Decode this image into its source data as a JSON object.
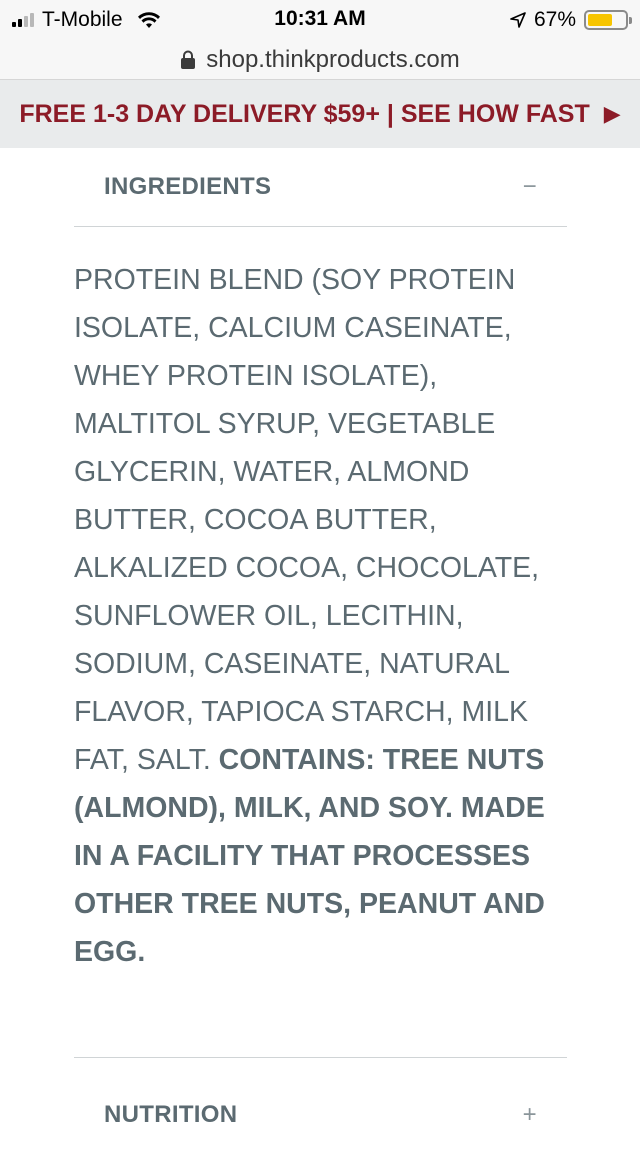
{
  "status_bar": {
    "carrier": "T-Mobile",
    "time": "10:31 AM",
    "battery_percent": "67%",
    "battery_level": 0.67,
    "icons": [
      "signal-icon",
      "wifi-icon",
      "location-arrow-icon",
      "battery-icon"
    ]
  },
  "browser": {
    "url": "shop.thinkproducts.com",
    "icons": [
      "lock-icon"
    ]
  },
  "promo": {
    "text": "FREE 1-3 DAY DELIVERY $59+ | SEE HOW FAST",
    "arrow": "▶",
    "color": "#8c1b27"
  },
  "ingredients_section": {
    "title": "INGREDIENTS",
    "toggle": "−",
    "body": "PROTEIN BLEND (SOY PROTEIN ISOLATE, CALCIUM CASEINATE, WHEY PROTEIN ISOLATE), MALTITOL SYRUP, VEGETABLE GLYCERIN, WATER, ALMOND BUTTER, COCOA BUTTER, ALKALIZED COCOA, CHOCOLATE, SUNFLOWER OIL, LECITHIN, SODIUM, CASEINATE, NATURAL FLAVOR, TAPIOCA STARCH, MILK FAT, SALT.",
    "allergens": "CONTAINS: TREE NUTS (ALMOND), MILK, AND SOY. MADE IN A FACILITY THAT PROCESSES OTHER TREE NUTS, PEANUT AND EGG."
  },
  "nutrition_section": {
    "title": "NUTRITION",
    "toggle": "+"
  },
  "colors": {
    "text": "#5b6a71",
    "banner_bg": "#e9ebec",
    "accent": "#8c1b27"
  }
}
